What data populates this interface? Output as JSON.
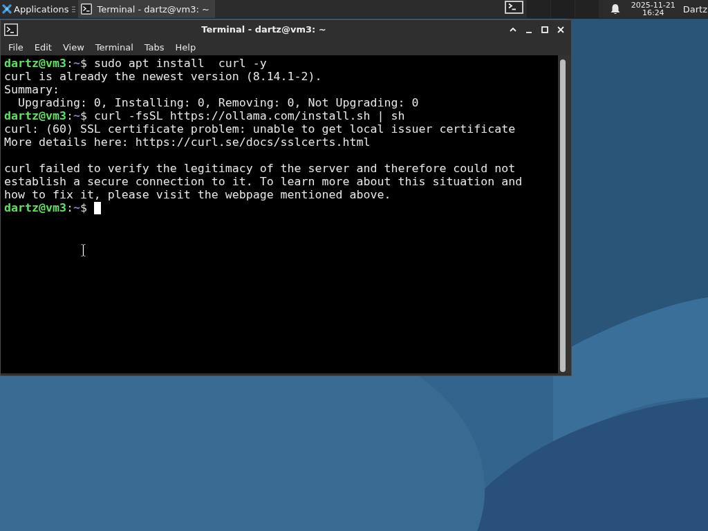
{
  "top_panel": {
    "app_menu": {
      "label": "Applications"
    },
    "tasks": [
      {
        "title": "Terminal - dartz@vm3: ~",
        "selected": true
      }
    ],
    "clock": {
      "date": "2025-11-21",
      "time": "16:24"
    },
    "user": "Dartz"
  },
  "window": {
    "title": "Terminal - dartz@vm3: ~",
    "menu": [
      "File",
      "Edit",
      "View",
      "Terminal",
      "Tabs",
      "Help"
    ],
    "terminal": {
      "entries": [
        {
          "kind": "prompt",
          "user_host": "dartz@vm3",
          "separator": ":",
          "directory": "~",
          "sign": "$",
          "command": "sudo apt install  curl -y",
          "cursor": false
        },
        {
          "kind": "output",
          "text": "curl is already the newest version (8.14.1-2).\nSummary:\n  Upgrading: 0, Installing: 0, Removing: 0, Not Upgrading: 0"
        },
        {
          "kind": "prompt",
          "user_host": "dartz@vm3",
          "separator": ":",
          "directory": "~",
          "sign": "$",
          "command": "curl -fsSL https://ollama.com/install.sh | sh",
          "cursor": false
        },
        {
          "kind": "output",
          "text": "curl: (60) SSL certificate problem: unable to get local issuer certificate\nMore details here: https://curl.se/docs/sslcerts.html\n\ncurl failed to verify the legitimacy of the server and therefore could not\nestablish a secure connection to it. To learn more about this situation and\nhow to fix it, please visit the webpage mentioned above."
        },
        {
          "kind": "prompt",
          "user_host": "dartz@vm3",
          "separator": ":",
          "directory": "~",
          "sign": "$",
          "cursor": true
        }
      ]
    }
  }
}
